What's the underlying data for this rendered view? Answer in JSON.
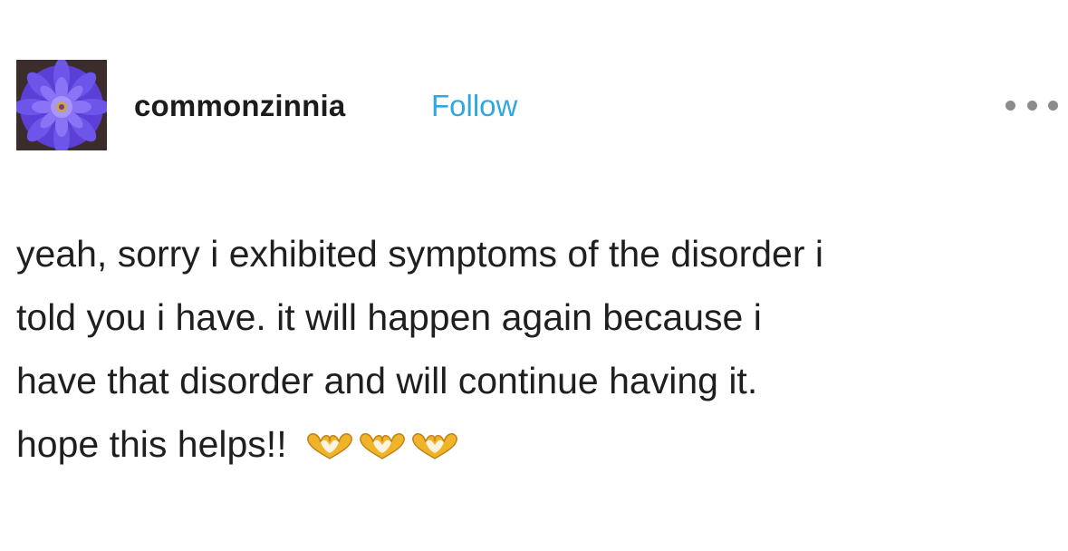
{
  "post": {
    "author": "commonzinnia",
    "follow_label": "Follow",
    "more_icon": "more-horizontal-icon",
    "avatar_icon": "purple-zinnia-flower-avatar",
    "body_lines": [
      "yeah, sorry i exhibited symptoms of the disorder i",
      "told you i have. it will happen again because i",
      "have that disorder and will continue having it.",
      "hope this helps!!"
    ],
    "emojis": [
      "heart-hands-icon",
      "heart-hands-icon",
      "heart-hands-icon"
    ]
  },
  "colors": {
    "follow": "#2fa8e0",
    "text": "#1f1f1f",
    "more_dots": "#8c8c8c",
    "emoji_gold": "#f0b429"
  }
}
